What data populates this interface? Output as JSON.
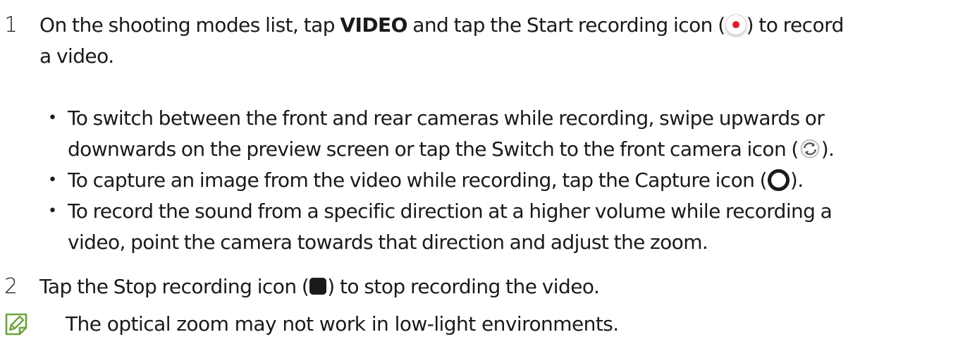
{
  "step1": {
    "number": "1",
    "text_before": "On the shooting modes list, tap ",
    "bold_term": "VIDEO",
    "text_middle": " and tap the Start recording icon (",
    "text_after_line1": ") to record",
    "text_line2": "a video.",
    "icon": "record-icon"
  },
  "bullets": [
    {
      "line1": "To switch between the front and rear cameras while recording, swipe upwards or",
      "line2_before": "downwards on the preview screen or tap the Switch to the front camera icon (",
      "line2_after": ").",
      "icon": "switch-camera-icon"
    },
    {
      "text_before": "To capture an image from the video while recording, tap the Capture icon (",
      "text_after": ").",
      "icon": "capture-icon"
    },
    {
      "line1": "To record the sound from a specific direction at a higher volume while recording a",
      "line2": "video, point the camera towards that direction and adjust the zoom."
    }
  ],
  "step2": {
    "number": "2",
    "text_before": "Tap the Stop recording icon (",
    "text_after": ") to stop recording the video.",
    "icon": "stop-icon"
  },
  "note": {
    "icon": "note-pencil-icon",
    "text": "The optical zoom may not work in low-light environments.",
    "icon_color": "#6aa437"
  },
  "colors": {
    "text": "#1a1a1a",
    "record_dot": "#e8192c",
    "note_icon": "#6aa437"
  }
}
